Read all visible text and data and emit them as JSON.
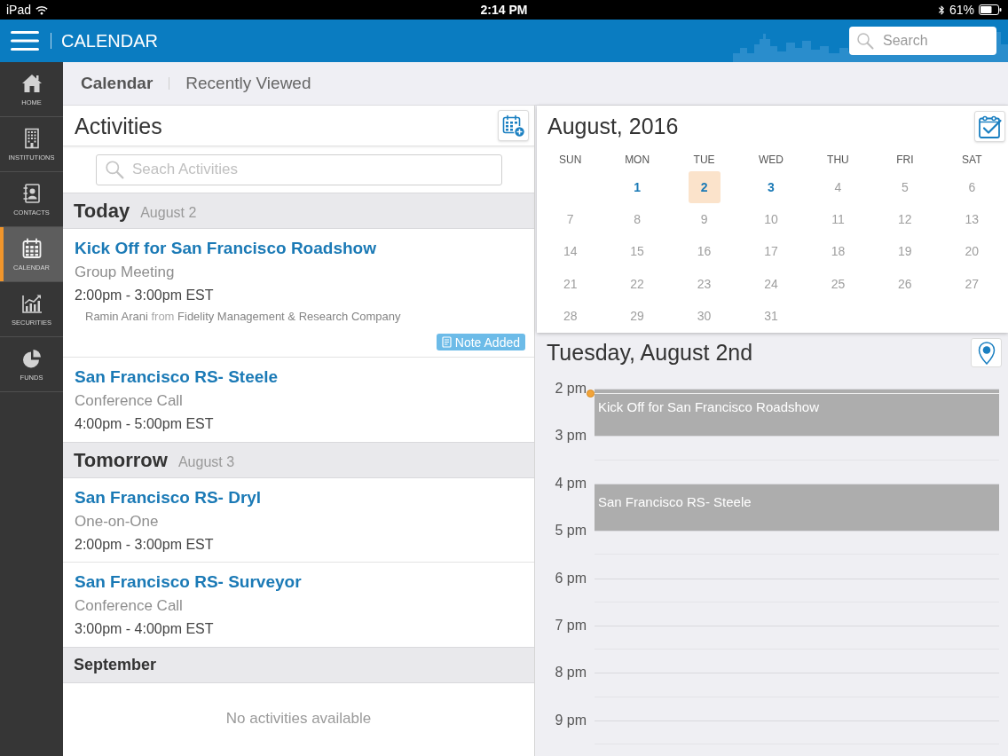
{
  "status_bar": {
    "device": "iPad",
    "time": "2:14 PM",
    "battery": "61%"
  },
  "header": {
    "title": "CALENDAR",
    "search": {
      "placeholder": "Search"
    }
  },
  "sidebar": {
    "items": [
      {
        "label": "HOME",
        "selected": false
      },
      {
        "label": "INSTITUTIONS",
        "selected": false
      },
      {
        "label": "CONTACTS",
        "selected": false
      },
      {
        "label": "CALENDAR",
        "selected": true
      },
      {
        "label": "SECURITIES",
        "selected": false
      },
      {
        "label": "FUNDS",
        "selected": false
      }
    ]
  },
  "subnav": {
    "tabs": [
      {
        "label": "Calendar",
        "selected": true
      },
      {
        "label": "Recently Viewed",
        "selected": false
      }
    ]
  },
  "activities": {
    "title": "Activities",
    "search": {
      "placeholder": "Seach Activities"
    },
    "groups": [
      {
        "kind": "day",
        "title": "Today",
        "date": "August 2",
        "items": [
          {
            "title": "Kick Off for San Francisco Roadshow",
            "type": "Group Meeting",
            "time": "2:00pm - 3:00pm EST",
            "contact": "Ramin Arani",
            "connector": "from",
            "organization": "Fidelity Management & Research Company",
            "badge": "Note Added"
          },
          {
            "title": "San Francisco RS- Steele",
            "type": "Conference Call",
            "time": "4:00pm - 5:00pm EST"
          }
        ]
      },
      {
        "kind": "day",
        "title": "Tomorrow",
        "date": "August 3",
        "items": [
          {
            "title": "San Francisco RS- Dryl",
            "type": "One-on-One",
            "time": "2:00pm - 3:00pm EST"
          },
          {
            "title": "San Francisco RS- Surveyor",
            "type": "Conference Call",
            "time": "3:00pm - 4:00pm EST"
          }
        ]
      },
      {
        "kind": "month",
        "title": "September",
        "empty_message": "No activities available"
      }
    ]
  },
  "month_calendar": {
    "title": "August, 2016",
    "weekdays": [
      "SUN",
      "MON",
      "TUE",
      "WED",
      "THU",
      "FRI",
      "SAT"
    ],
    "weeks": [
      {
        "days": [
          {
            "label": "1",
            "has_events": true,
            "selected": false
          },
          {
            "label": "2",
            "has_events": true,
            "selected": true
          },
          {
            "label": "3",
            "has_events": true,
            "selected": false
          },
          {
            "label": "4",
            "has_events": false,
            "selected": false
          },
          {
            "label": "5",
            "has_events": false,
            "selected": false
          },
          {
            "label": "6",
            "has_events": false,
            "selected": false
          }
        ]
      },
      {
        "days": [
          {
            "label": "7",
            "has_events": false,
            "selected": false
          },
          {
            "label": "8",
            "has_events": false,
            "selected": false
          },
          {
            "label": "9",
            "has_events": false,
            "selected": false
          },
          {
            "label": "10",
            "has_events": false,
            "selected": false
          },
          {
            "label": "11",
            "has_events": false,
            "selected": false
          },
          {
            "label": "12",
            "has_events": false,
            "selected": false
          },
          {
            "label": "13",
            "has_events": false,
            "selected": false
          }
        ]
      },
      {
        "days": [
          {
            "label": "14",
            "has_events": false,
            "selected": false
          },
          {
            "label": "15",
            "has_events": false,
            "selected": false
          },
          {
            "label": "16",
            "has_events": false,
            "selected": false
          },
          {
            "label": "17",
            "has_events": false,
            "selected": false
          },
          {
            "label": "18",
            "has_events": false,
            "selected": false
          },
          {
            "label": "19",
            "has_events": false,
            "selected": false
          },
          {
            "label": "20",
            "has_events": false,
            "selected": false
          }
        ]
      },
      {
        "days": [
          {
            "label": "21",
            "has_events": false,
            "selected": false
          },
          {
            "label": "22",
            "has_events": false,
            "selected": false
          },
          {
            "label": "23",
            "has_events": false,
            "selected": false
          },
          {
            "label": "24",
            "has_events": false,
            "selected": false
          },
          {
            "label": "25",
            "has_events": false,
            "selected": false
          },
          {
            "label": "26",
            "has_events": false,
            "selected": false
          },
          {
            "label": "27",
            "has_events": false,
            "selected": false
          }
        ]
      },
      {
        "days": [
          {
            "label": "28",
            "has_events": false,
            "selected": false
          },
          {
            "label": "29",
            "has_events": false,
            "selected": false
          },
          {
            "label": "30",
            "has_events": false,
            "selected": false
          },
          {
            "label": "31",
            "has_events": false,
            "selected": false
          }
        ]
      }
    ]
  },
  "day_view": {
    "title": "Tuesday, August 2nd",
    "hours": [
      {
        "label": "2 pm",
        "event": "Kick Off for San Francisco Roadshow",
        "now": true
      },
      {
        "label": "3 pm",
        "now": false
      },
      {
        "label": "4 pm",
        "event": "San Francisco RS- Steele",
        "now": false
      },
      {
        "label": "5 pm",
        "now": false
      },
      {
        "label": "6 pm",
        "now": false
      },
      {
        "label": "7 pm",
        "now": false
      },
      {
        "label": "8 pm",
        "now": false
      },
      {
        "label": "9 pm",
        "now": false
      }
    ]
  }
}
